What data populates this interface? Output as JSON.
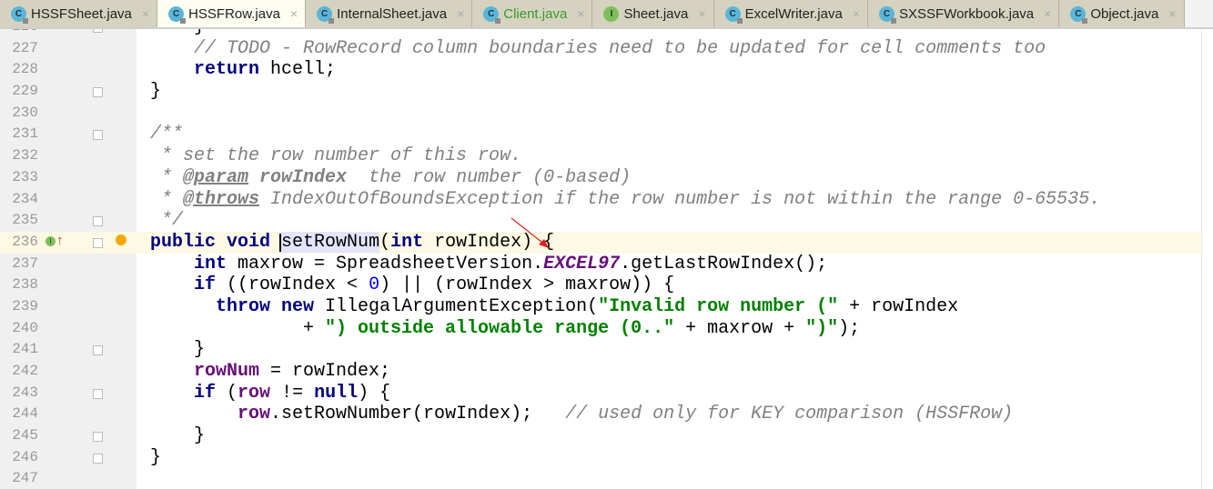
{
  "tabs": [
    {
      "label": "HSSFSheet.java",
      "icon": "class-icon",
      "active": false
    },
    {
      "label": "HSSFRow.java",
      "icon": "class-icon",
      "active": true
    },
    {
      "label": "InternalSheet.java",
      "icon": "class-icon",
      "active": false
    },
    {
      "label": "Client.java",
      "icon": "class-icon",
      "active": false,
      "green": true
    },
    {
      "label": "Sheet.java",
      "icon": "interface-icon",
      "active": false
    },
    {
      "label": "ExcelWriter.java",
      "icon": "class-icon",
      "active": false
    },
    {
      "label": "SXSSFWorkbook.java",
      "icon": "class-icon",
      "active": false
    },
    {
      "label": "Object.java",
      "icon": "class-icon",
      "active": false
    }
  ],
  "close_glyph": "×",
  "colors": {
    "keyword": "#000080",
    "string": "#008000",
    "comment": "#808080",
    "field": "#660e7a",
    "number": "#0000ff",
    "current_line": "#fdf9e3"
  },
  "lines": [
    {
      "n": "226",
      "fold": true,
      "tokens": [
        [
          "    }",
          ""
        ]
      ]
    },
    {
      "n": "227",
      "tokens": [
        [
          "    ",
          ""
        ],
        [
          "// TODO - RowRecord column boundaries need to be updated for cell comments too",
          "cm"
        ]
      ]
    },
    {
      "n": "228",
      "tokens": [
        [
          "    ",
          ""
        ],
        [
          "return",
          "kw"
        ],
        [
          " hcell;",
          ""
        ]
      ]
    },
    {
      "n": "229",
      "fold": true,
      "tokens": [
        [
          "}",
          ""
        ]
      ]
    },
    {
      "n": "230",
      "tokens": []
    },
    {
      "n": "231",
      "fold": true,
      "tokens": [
        [
          "/**",
          "cm"
        ]
      ]
    },
    {
      "n": "232",
      "tokens": [
        [
          " * set the row number of this row.",
          "cm"
        ]
      ]
    },
    {
      "n": "233",
      "tokens": [
        [
          " * ",
          "cm"
        ],
        [
          "@param",
          "dt"
        ],
        [
          " ",
          "cm"
        ],
        [
          "rowIndex",
          "dp"
        ],
        [
          "  the row number (0-based)",
          "cm"
        ]
      ]
    },
    {
      "n": "234",
      "tokens": [
        [
          " * ",
          "cm"
        ],
        [
          "@throws",
          "dt"
        ],
        [
          " IndexOutOfBoundsException",
          "cm"
        ],
        [
          " if the row number is not within the range 0-65535.",
          "cm"
        ]
      ]
    },
    {
      "n": "235",
      "fold": true,
      "tokens": [
        [
          " */",
          "cm"
        ]
      ]
    },
    {
      "n": "236",
      "fold": true,
      "current": true,
      "tokens": [
        [
          "public void",
          "kw"
        ],
        [
          " ",
          ""
        ],
        [
          "setRowNum",
          "sel"
        ],
        [
          "(",
          ""
        ],
        [
          "int",
          "kw"
        ],
        [
          " rowIndex) {",
          ""
        ]
      ]
    },
    {
      "n": "237",
      "tokens": [
        [
          "    ",
          ""
        ],
        [
          "int",
          "kw"
        ],
        [
          " maxrow = SpreadsheetVersion.",
          ""
        ],
        [
          "EXCEL97",
          "sf"
        ],
        [
          ".getLastRowIndex();",
          ""
        ]
      ]
    },
    {
      "n": "238",
      "tokens": [
        [
          "    ",
          ""
        ],
        [
          "if",
          "kw"
        ],
        [
          " ((rowIndex < ",
          ""
        ],
        [
          "0",
          "nm"
        ],
        [
          ") || (rowIndex > maxrow)) {",
          ""
        ]
      ]
    },
    {
      "n": "239",
      "tokens": [
        [
          "      ",
          ""
        ],
        [
          "throw new",
          "kw"
        ],
        [
          " IllegalArgumentException(",
          ""
        ],
        [
          "\"Invalid row number (\"",
          "str"
        ],
        [
          " + rowIndex",
          ""
        ]
      ]
    },
    {
      "n": "240",
      "tokens": [
        [
          "              + ",
          ""
        ],
        [
          "\") outside allowable range (0..\"",
          "str"
        ],
        [
          " + maxrow + ",
          ""
        ],
        [
          "\")\"",
          "str"
        ],
        [
          ");",
          ""
        ]
      ]
    },
    {
      "n": "241",
      "fold": true,
      "tokens": [
        [
          "    }",
          ""
        ]
      ]
    },
    {
      "n": "242",
      "tokens": [
        [
          "    ",
          ""
        ],
        [
          "rowNum",
          "fd"
        ],
        [
          " = rowIndex;",
          ""
        ]
      ]
    },
    {
      "n": "243",
      "fold": true,
      "tokens": [
        [
          "    ",
          ""
        ],
        [
          "if",
          "kw"
        ],
        [
          " (",
          ""
        ],
        [
          "row",
          "fd"
        ],
        [
          " != ",
          ""
        ],
        [
          "null",
          "kw"
        ],
        [
          ") {",
          ""
        ]
      ]
    },
    {
      "n": "244",
      "tokens": [
        [
          "        ",
          ""
        ],
        [
          "row",
          "fd"
        ],
        [
          ".setRowNumber(rowIndex);   ",
          ""
        ],
        [
          "// used only for KEY comparison (HSSFRow)",
          "cm"
        ]
      ]
    },
    {
      "n": "245",
      "fold": true,
      "tokens": [
        [
          "    }",
          ""
        ]
      ]
    },
    {
      "n": "246",
      "fold": true,
      "tokens": [
        [
          "}",
          ""
        ]
      ]
    },
    {
      "n": "247",
      "tokens": []
    }
  ],
  "gutter_marks": {
    "implements_icon": "I",
    "override_arrow": "↑"
  }
}
